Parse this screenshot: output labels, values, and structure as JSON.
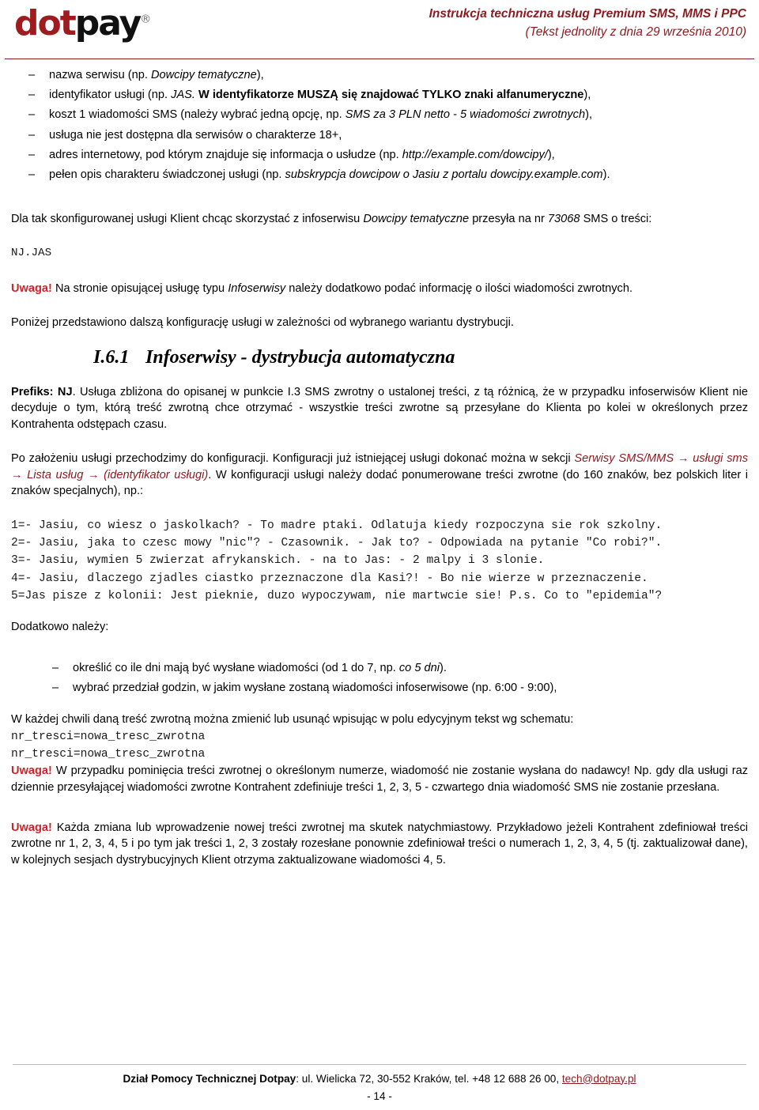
{
  "header": {
    "logo": {
      "dot": "dot",
      "pay": "pay",
      "reg": "®"
    },
    "title_line1": "Instrukcja techniczna usług Premium SMS, MMS i PPC",
    "title_line2": "(Tekst jednolity z dnia 29 września 2010)",
    "accent_color": "#8c1a1f"
  },
  "bullet_char": "–",
  "list_top": [
    {
      "pre": "nazwa serwisu (np. ",
      "italic": "Dowcipy tematyczne",
      "post": "),",
      "bold": ""
    },
    {
      "pre": "identyfikator usługi (np. ",
      "italic": "JAS.",
      "bold": " W identyfikatorze MUSZĄ się znajdować TYLKO znaki alfanumeryczne",
      "post": "),"
    },
    {
      "pre": "koszt 1 wiadomości SMS (należy wybrać jedną opcję, np. ",
      "italic": "SMS za 3 PLN netto - 5 wiadomości zwrotnych",
      "bold": "",
      "post": "),"
    },
    {
      "pre": "usługa nie jest dostępna dla serwisów o charakterze 18+,",
      "italic": "",
      "bold": "",
      "post": ""
    },
    {
      "pre": "adres internetowy, pod którym znajduje się informacja o usłudze (np. ",
      "italic": "http://example.com/dowcipy/",
      "bold": "",
      "post": "),"
    },
    {
      "pre": "pełen opis charakteru świadczonej usługi (np. ",
      "italic": "subskrypcja dowcipow o Jasiu z portalu dowcipy.example.com",
      "bold": "",
      "post": ")."
    }
  ],
  "para_config": {
    "part1": "Dla tak skonfigurowanej usługi Klient chcąc skorzystać z infoserwisu ",
    "italic1": "Dowcipy tematyczne",
    "part2": " przesyła na nr ",
    "italic2": "73068",
    "part3": " SMS o treści:"
  },
  "code_njjas": "NJ.JAS",
  "para_uwaga1": {
    "label": "Uwaga!",
    "part1": " Na stronie opisującej usługę typu ",
    "italic1": "Infoserwisy",
    "part2": " należy dodatkowo podać informację o ilości wiadomości zwrotnych."
  },
  "para_ponizej": "Poniżej przedstawiono dalszą konfigurację usługi w zależności od wybranego wariantu dystrybucji.",
  "section": {
    "number": "I.6.1",
    "title": "Infoserwisy - dystrybucja automatyczna"
  },
  "para_prefiks": {
    "bold": "Prefiks: NJ",
    "rest": ". Usługa zbliżona do opisanej w punkcie I.3 SMS zwrotny o ustalonej treści, z tą różnicą, że w przypadku infoserwisów Klient nie decyduje o tym, którą treść zwrotną chce otrzymać - wszystkie treści zwrotne są przesyłane do Klienta po kolei w określonych przez Kontrahenta odstępach czasu."
  },
  "para_zalozenie": {
    "part1": "Po założeniu usługi przechodzimy do konfiguracji. Konfiguracji już istniejącej usługi dokonać można w sekcji ",
    "redpath": "Serwisy SMS/MMS → usługi sms → Lista usług → (identyfikator usługi)",
    "part2": ". W konfiguracji usługi należy dodać ponumerowane treści zwrotne (do 160 znaków, bez polskich liter i znaków specjalnych), np.:"
  },
  "code_tresci": [
    "1=- Jasiu, co wiesz o jaskolkach? - To madre ptaki. Odlatuja kiedy rozpoczyna sie rok szkolny.",
    "2=- Jasiu, jaka to czesc mowy \"nic\"? - Czasownik. - Jak to? - Odpowiada na pytanie \"Co robi?\".",
    "3=- Jasiu, wymien 5 zwierzat afrykanskich. - na to Jas: - 2 malpy i 3 slonie.",
    "4=- Jasiu, dlaczego zjadles ciastko przeznaczone dla Kasi?! - Bo nie wierze w przeznaczenie.",
    "5=Jas pisze z kolonii: Jest pieknie, duzo wypoczywam, nie martwcie sie! P.s. Co to \"epidemia\"?"
  ],
  "para_dodatkowo": "Dodatkowo należy:",
  "list_dodatkowo": [
    {
      "pre": "określić co ile dni mają być wysłane wiadomości (od 1 do 7, np. ",
      "italic": "co 5 dni",
      "post": ")."
    },
    {
      "pre": "wybrać przedział godzin, w jakim wysłane zostaną wiadomości infoserwisowe (np. 6:00 - 9:00),",
      "italic": "",
      "post": ""
    }
  ],
  "para_wkazdej": "W każdej chwili daną treść zwrotną można zmienić lub usunąć wpisując w polu edycyjnym tekst wg schematu:",
  "code_schemat": [
    "nr_tresci=nowa_tresc_zwrotna",
    "nr_tresci=nowa_tresc_zwrotna"
  ],
  "para_uwaga2": {
    "label": "Uwaga!",
    "text": " W przypadku pominięcia treści zwrotnej o określonym numerze, wiadomość nie zostanie wysłana do nadawcy! Np. gdy dla usługi raz dziennie przesyłającej wiadomości zwrotne Kontrahent zdefiniuje treści 1, 2, 3, 5 - czwartego dnia wiadomość SMS nie zostanie przesłana."
  },
  "para_uwaga3": {
    "label": "Uwaga!",
    "text": " Każda zmiana lub wprowadzenie nowej treści zwrotnej ma skutek natychmiastowy. Przykładowo jeżeli Kontrahent zdefiniował treści zwrotne nr 1, 2, 3, 4, 5 i po tym jak treści 1, 2, 3 zostały rozesłane ponownie zdefiniował treści o numerach 1, 2, 3, 4, 5 (tj. zaktualizował dane), w kolejnych sesjach dystrybucyjnych Klient otrzyma zaktualizowane wiadomości 4, 5."
  },
  "footer": {
    "dept": "Dział Pomocy Technicznej Dotpay",
    "address": ": ul. Wielicka 72, 30-552 Kraków, tel. +48 12 688 26 00, ",
    "email": "tech@dotpay.pl",
    "page": "- 14 -"
  }
}
